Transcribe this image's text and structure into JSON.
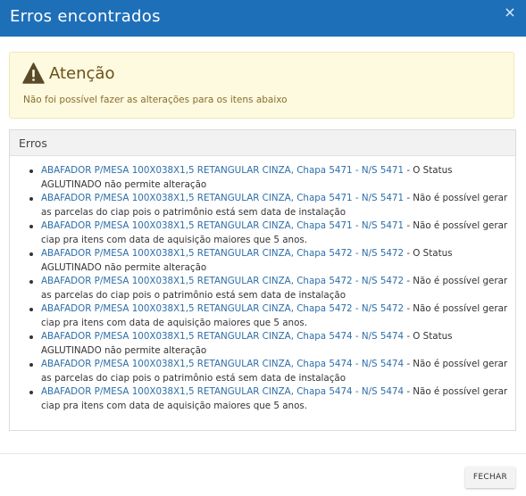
{
  "dialog": {
    "title": "Erros encontrados",
    "close_symbol": "×",
    "close_icon": "close-icon"
  },
  "alert": {
    "icon": "warning-icon",
    "title": "Atenção",
    "message": "Não foi possível fazer as alterações para os itens abaixo",
    "colors": {
      "background": "#fdfae0",
      "border": "#f2e7b4",
      "icon": "#5b4a2a"
    }
  },
  "errors_panel": {
    "title": "Erros",
    "items": [
      {
        "link": "ABAFADOR P/MESA 100X038X1,5 RETANGULAR CINZA, Chapa 5471 - N/S 5471",
        "message": " - O Status AGLUTINADO não permite alteração"
      },
      {
        "link": "ABAFADOR P/MESA 100X038X1,5 RETANGULAR CINZA, Chapa 5471 - N/S 5471",
        "message": " - Não é possível gerar as parcelas do ciap pois o patrimônio está sem data de instalação"
      },
      {
        "link": "ABAFADOR P/MESA 100X038X1,5 RETANGULAR CINZA, Chapa 5471 - N/S 5471",
        "message": " - Não é possível gerar ciap pra itens com data de aquisição maiores que 5 anos."
      },
      {
        "link": "ABAFADOR P/MESA 100X038X1,5 RETANGULAR CINZA, Chapa 5472 - N/S 5472",
        "message": " - O Status AGLUTINADO não permite alteração"
      },
      {
        "link": "ABAFADOR P/MESA 100X038X1,5 RETANGULAR CINZA, Chapa 5472 - N/S 5472",
        "message": " - Não é possível gerar as parcelas do ciap pois o patrimônio está sem data de instalação"
      },
      {
        "link": "ABAFADOR P/MESA 100X038X1,5 RETANGULAR CINZA, Chapa 5472 - N/S 5472",
        "message": " - Não é possível gerar ciap pra itens com data de aquisição maiores que 5 anos."
      },
      {
        "link": "ABAFADOR P/MESA 100X038X1,5 RETANGULAR CINZA, Chapa 5474 - N/S 5474",
        "message": " - O Status AGLUTINADO não permite alteração"
      },
      {
        "link": "ABAFADOR P/MESA 100X038X1,5 RETANGULAR CINZA, Chapa 5474 - N/S 5474",
        "message": " - Não é possível gerar as parcelas do ciap pois o patrimônio está sem data de instalação"
      },
      {
        "link": "ABAFADOR P/MESA 100X038X1,5 RETANGULAR CINZA, Chapa 5474 - N/S 5474",
        "message": " - Não é possível gerar ciap pra itens com data de aquisição maiores que 5 anos."
      }
    ]
  },
  "footer": {
    "close_label": "FECHAR"
  },
  "colors": {
    "header": "#1d6fb8",
    "link": "#2d6ea8"
  }
}
